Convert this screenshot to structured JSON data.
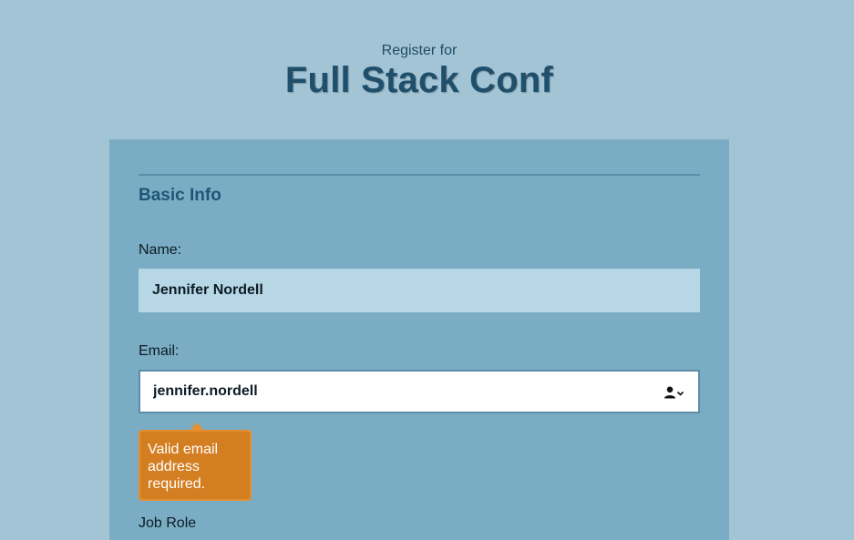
{
  "header": {
    "register_for": "Register for",
    "conf_title": "Full Stack Conf"
  },
  "form": {
    "section_title": "Basic Info",
    "name": {
      "label": "Name:",
      "value": "Jennifer Nordell"
    },
    "email": {
      "label": "Email:",
      "value": "jennifer.nordell",
      "autofill_icon": "contact-card-autofill-icon"
    },
    "validation": {
      "message": "Valid email address required."
    },
    "job_role": {
      "label": "Job Role"
    }
  },
  "colors": {
    "page_bg": "#a3c4d5",
    "card_bg": "#7aacc4",
    "title": "#1f4f6b",
    "name_input_bg": "#b7d7e6",
    "tooltip_bg": "#d47e22"
  }
}
